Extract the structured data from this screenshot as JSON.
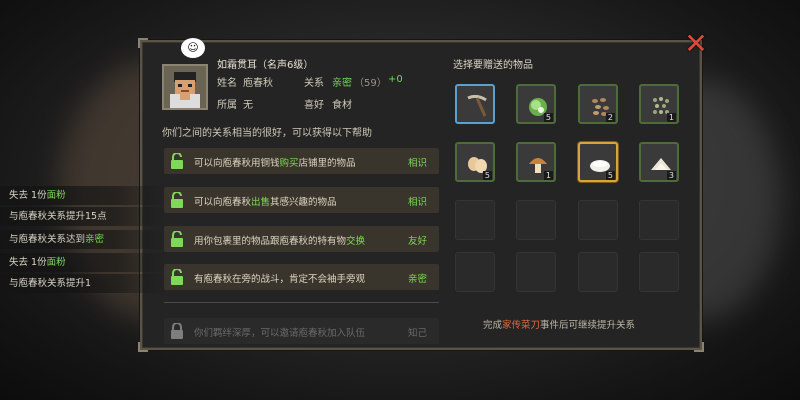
{
  "npc": {
    "title": "如霜贯耳（名声6级）",
    "name_label": "姓名",
    "name_value": "庖春秋",
    "relation_label": "关系",
    "relation_value": "亲密",
    "relation_points": "（59）",
    "relation_delta": "+0",
    "faction_label": "所属",
    "faction_value": "无",
    "likes_label": "喜好",
    "likes_value": "食材",
    "chat_icon": "speech-bubble-icon"
  },
  "relationship_desc": "你们之间的关系相当的很好，可以获得以下帮助",
  "benefits": [
    {
      "pre": "可以向庖春秋用铜钱",
      "hl": "购买",
      "post": "店铺里的物品",
      "level": "相识",
      "locked": false
    },
    {
      "pre": "可以向庖春秋",
      "hl": "出售",
      "post": "其感兴趣的物品",
      "level": "相识",
      "locked": false
    },
    {
      "pre": "用你包裹里的物品跟庖春秋的特有物",
      "hl": "交换",
      "post": "",
      "level": "友好",
      "locked": false
    },
    {
      "pre": "有庖春秋在旁的战斗，肯定不会袖手旁观",
      "hl": "",
      "post": "",
      "level": "亲密",
      "locked": false
    },
    {
      "pre": "你们羁绊深厚，可以邀请庖春秋加入队伍",
      "hl": "",
      "post": "",
      "level": "知己",
      "locked": true
    }
  ],
  "gift": {
    "title": "选择要赠送的物品",
    "items": [
      {
        "name": "pickaxe-item",
        "count": ""
      },
      {
        "name": "cabbage-item",
        "count": "5"
      },
      {
        "name": "peanuts-item",
        "count": "2"
      },
      {
        "name": "beans-item",
        "count": "1"
      },
      {
        "name": "eggs-item",
        "count": "5"
      },
      {
        "name": "mushroom-item",
        "count": "1"
      },
      {
        "name": "rice-bowl-item",
        "count": "5"
      },
      {
        "name": "flour-item",
        "count": "3"
      }
    ]
  },
  "footer": {
    "pre": "完成",
    "hl": "家传菜刀",
    "post": "事件后可继续提升关系"
  },
  "log": [
    {
      "pre": "失去 1份",
      "hl": "面粉",
      "post": ""
    },
    {
      "pre": "与庖春秋关系提升15点",
      "hl": "",
      "post": ""
    },
    {
      "pre": "与庖春秋关系达到",
      "hl": "亲密",
      "post": ""
    },
    {
      "pre": "失去 1份",
      "hl": "面粉",
      "post": ""
    },
    {
      "pre": "与庖春秋关系提升1",
      "hl": "",
      "post": ""
    }
  ],
  "colors": {
    "accent_green": "#7ed957",
    "highlight_orange": "#e06a3a",
    "close_red": "#d84a3a",
    "selected_gold": "#d9a43a",
    "selected_blue": "#5aa0d0"
  }
}
